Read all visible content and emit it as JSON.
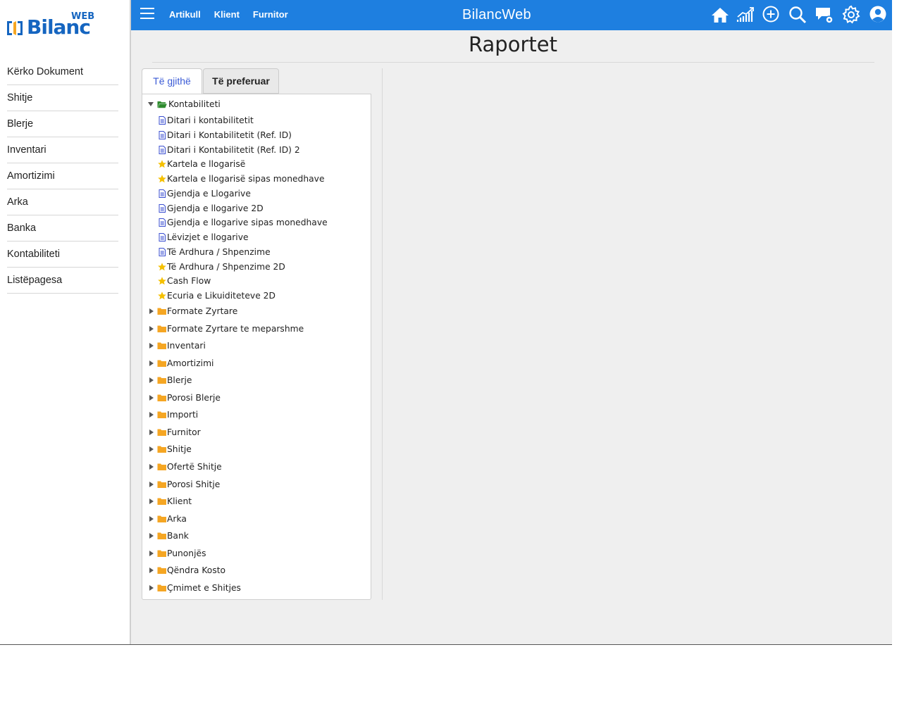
{
  "logo": {
    "brand": "Bilanc",
    "suffix": "WEB"
  },
  "sidebar": {
    "items": [
      {
        "label": "Kërko Dokument"
      },
      {
        "label": "Shitje"
      },
      {
        "label": "Blerje"
      },
      {
        "label": "Inventari"
      },
      {
        "label": "Amortizimi"
      },
      {
        "label": "Arka"
      },
      {
        "label": "Banka"
      },
      {
        "label": "Kontabiliteti"
      },
      {
        "label": "Listëpagesa"
      }
    ]
  },
  "topbar": {
    "nav": [
      {
        "label": "Artikull"
      },
      {
        "label": "Klient"
      },
      {
        "label": "Furnitor"
      }
    ],
    "app_title": "BilancWeb",
    "icons": [
      "home-icon",
      "chart-icon",
      "add-icon",
      "search-icon",
      "chat-settings-icon",
      "gear-icon",
      "user-icon"
    ]
  },
  "page": {
    "title": "Raportet",
    "tabs": [
      {
        "label": "Të gjithë"
      },
      {
        "label": "Të preferuar"
      }
    ]
  },
  "tree": {
    "root": {
      "label": "Kontabiliteti",
      "children": [
        {
          "label": "Ditari i kontabilitetit",
          "icon": "doc"
        },
        {
          "label": "Ditari i Kontabilitetit (Ref. ID)",
          "icon": "doc"
        },
        {
          "label": "Ditari i Kontabilitetit (Ref. ID) 2",
          "icon": "doc"
        },
        {
          "label": "Kartela e llogarisë",
          "icon": "star"
        },
        {
          "label": "Kartela e llogarisë sipas monedhave",
          "icon": "star"
        },
        {
          "label": "Gjendja e Llogarive",
          "icon": "doc"
        },
        {
          "label": "Gjendja e llogarive 2D",
          "icon": "doc"
        },
        {
          "label": "Gjendja e llogarive sipas monedhave",
          "icon": "doc"
        },
        {
          "label": "Lëvizjet e llogarive",
          "icon": "doc"
        },
        {
          "label": "Të Ardhura / Shpenzime",
          "icon": "doc"
        },
        {
          "label": "Të Ardhura / Shpenzime 2D",
          "icon": "star"
        },
        {
          "label": "Cash Flow",
          "icon": "star"
        },
        {
          "label": "Ecuria e Likuiditeteve 2D",
          "icon": "star"
        }
      ]
    },
    "folders": [
      {
        "label": "Formate Zyrtare"
      },
      {
        "label": "Formate Zyrtare te meparshme"
      },
      {
        "label": "Inventari"
      },
      {
        "label": "Amortizimi"
      },
      {
        "label": "Blerje"
      },
      {
        "label": "Porosi Blerje"
      },
      {
        "label": "Importi"
      },
      {
        "label": "Furnitor"
      },
      {
        "label": "Shitje"
      },
      {
        "label": "Ofertë Shitje"
      },
      {
        "label": "Porosi Shitje"
      },
      {
        "label": "Klient"
      },
      {
        "label": "Arka"
      },
      {
        "label": "Bank"
      },
      {
        "label": "Punonjës"
      },
      {
        "label": "Qëndra Kosto"
      },
      {
        "label": "Çmimet e Shitjes"
      }
    ]
  },
  "colors": {
    "topbar": "#1e7fe0",
    "brand": "#1565c0",
    "folder": "#f5a623",
    "open_folder": "#2e8b2e",
    "star": "#f5c000",
    "doc": "#3b4fd0"
  }
}
